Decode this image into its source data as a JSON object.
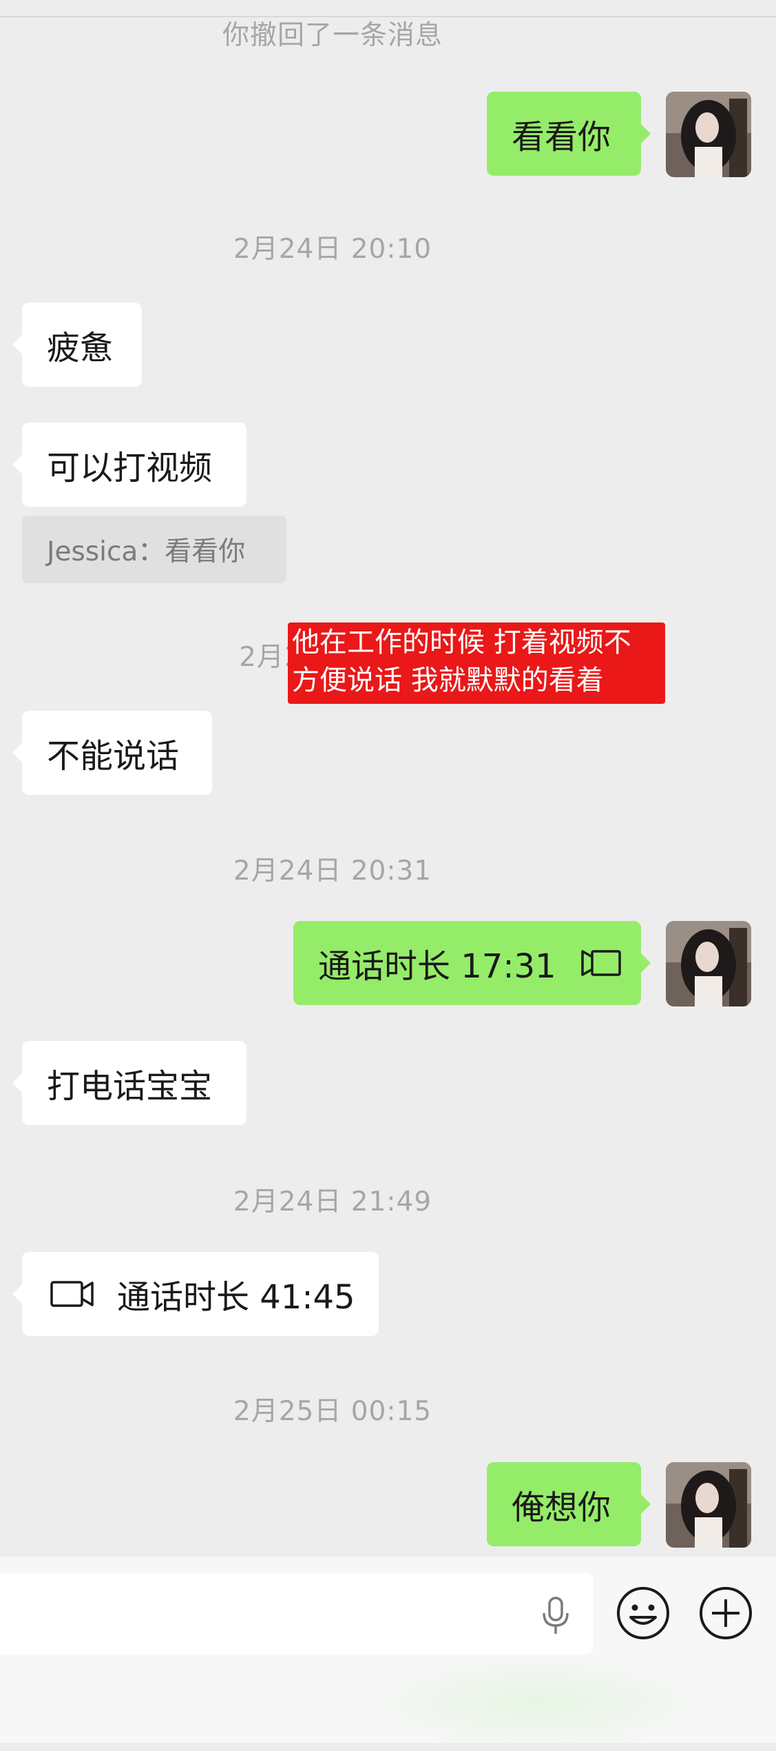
{
  "recalled_notice": "你撤回了一条消息",
  "messages": {
    "m1": "看看你",
    "ts1": "2月24日 20:10",
    "m2": "疲惫",
    "m3": "可以打视频",
    "quote": "Jessica：看看你",
    "ts2_partial": "2月2",
    "m4": "不能说话",
    "ts3": "2月24日 20:31",
    "call1": "通话时长 17:31",
    "m5": "打电话宝宝",
    "ts4": "2月24日 21:49",
    "call2": "通话时长 41:45",
    "ts5": "2月25日 00:15",
    "m6": "俺想你"
  },
  "annotation": {
    "line1": "他在工作的时候 打着视频不",
    "line2": "方便说话 我就默默的看着"
  },
  "colors": {
    "background": "#ededed",
    "sent_bubble": "#95ec69",
    "received_bubble": "#ffffff",
    "annotation_bg": "#ea1818"
  },
  "icons": {
    "video_call": "video-camera-icon",
    "voice": "microphone-icon",
    "emoji": "emoji-icon",
    "more": "plus-circle-icon"
  }
}
